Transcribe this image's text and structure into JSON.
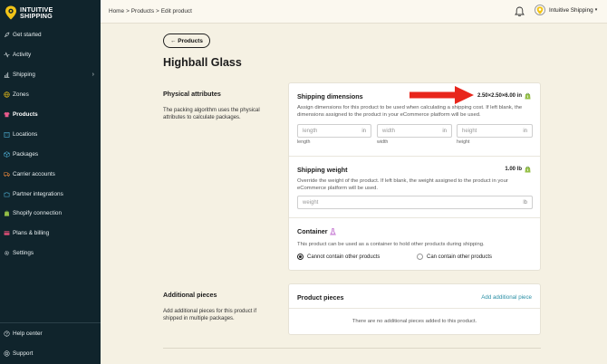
{
  "brand": {
    "line1": "INTUITIVE",
    "line2": "SHIPPING"
  },
  "sidebar": {
    "items": [
      {
        "label": "Get started",
        "icon": "rocket-icon",
        "active": false
      },
      {
        "label": "Activity",
        "icon": "pulse-icon",
        "active": false
      },
      {
        "label": "Shipping",
        "icon": "chart-icon",
        "active": false,
        "has_chevron": true
      },
      {
        "label": "Zones",
        "icon": "globe-icon",
        "active": false
      },
      {
        "label": "Products",
        "icon": "shirt-icon",
        "active": true
      },
      {
        "label": "Locations",
        "icon": "building-icon",
        "active": false
      },
      {
        "label": "Packages",
        "icon": "box-icon",
        "active": false
      },
      {
        "label": "Carrier accounts",
        "icon": "truck-icon",
        "active": false
      },
      {
        "label": "Partner integrations",
        "icon": "puzzle-icon",
        "active": false
      },
      {
        "label": "Shopify connection",
        "icon": "shopify-icon",
        "active": false
      },
      {
        "label": "Plans & billing",
        "icon": "card-icon",
        "active": false
      },
      {
        "label": "Settings",
        "icon": "gear-icon",
        "active": false
      }
    ],
    "bottom": [
      {
        "label": "Help center",
        "icon": "help-icon"
      },
      {
        "label": "Support",
        "icon": "support-icon"
      }
    ],
    "chevron": "›"
  },
  "topbar": {
    "breadcrumb": [
      "Home",
      "Products",
      "Edit product"
    ],
    "separator": ">",
    "user_name": "Intuitive Shipping",
    "caret": "▾"
  },
  "page": {
    "back_label": "← Products",
    "title": "Highball Glass"
  },
  "physical": {
    "title": "Physical attributes",
    "desc": "The packing algorithm uses the physical attributes to calculate packages."
  },
  "dimensions": {
    "title": "Shipping dimensions",
    "value": "2.50×2.50×6.00 in",
    "desc": "Assign dimensions for this product to be used when calculating a shipping cost. If left blank, the dimensions assigned to the product in your eCommerce platform will be used.",
    "fields": [
      {
        "placeholder": "length",
        "unit": "in",
        "caption": "length"
      },
      {
        "placeholder": "width",
        "unit": "in",
        "caption": "width"
      },
      {
        "placeholder": "height",
        "unit": "in",
        "caption": "height"
      }
    ]
  },
  "weight": {
    "title": "Shipping weight",
    "value": "1.00 lb",
    "desc": "Override the weight of the product. If left blank, the weight assigned to the product in your eCommerce platform will be used.",
    "placeholder": "weight",
    "unit": "lb"
  },
  "container": {
    "title": "Container",
    "desc": "This product can be used as a container to hold other products during shipping.",
    "options": [
      {
        "label": "Cannot contain other products",
        "selected": true
      },
      {
        "label": "Can contain other products",
        "selected": false
      }
    ]
  },
  "additional": {
    "title": "Additional pieces",
    "desc": "Add additional pieces for this product if shipped in multiple packages.",
    "card_title": "Product pieces",
    "add_link": "Add additional piece",
    "empty": "There are no additional pieces added to this product."
  },
  "colors": {
    "sidebar_bg": "#10242c",
    "page_bg": "#f5f1e3",
    "accent_link": "#2a8fa5",
    "shopify_green": "#95bf47",
    "arrow_red": "#e8261c",
    "logo_yellow": "#f2c418"
  }
}
